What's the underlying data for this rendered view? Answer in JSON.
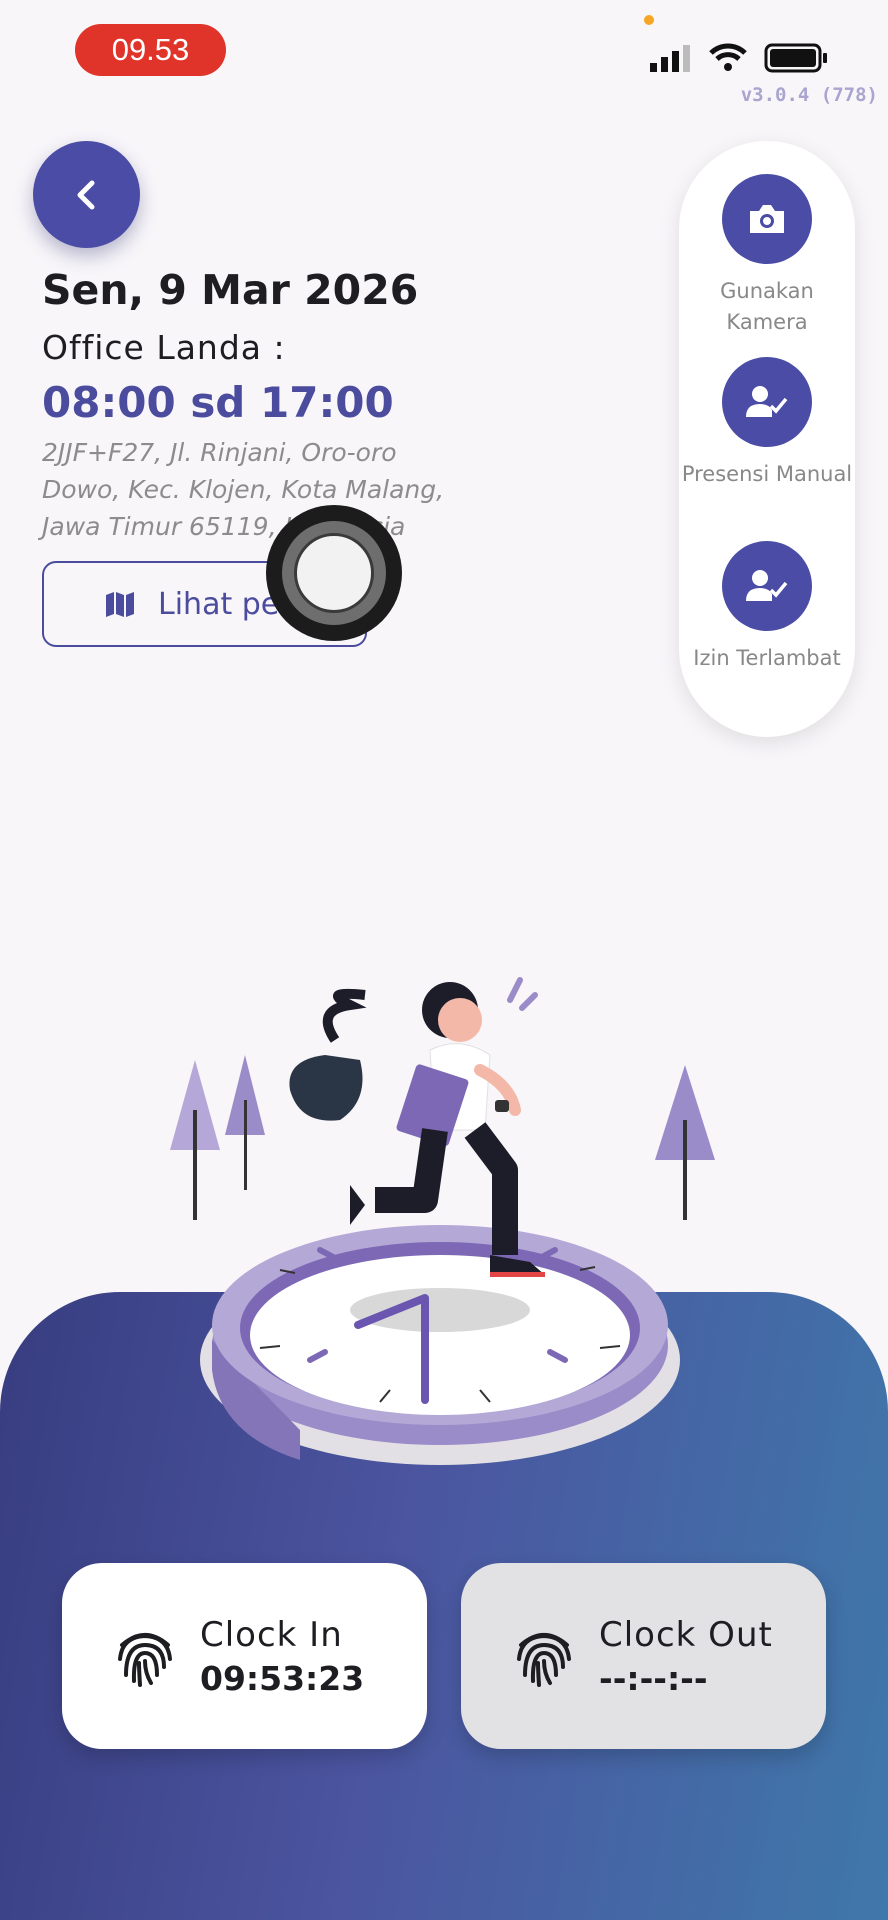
{
  "status_bar": {
    "time": "09.53",
    "version": "v3.0.4 (778)"
  },
  "header": {
    "date": "Sen, 9 Mar 2026",
    "office": "Office Landa :",
    "hours": "08:00 sd 17:00",
    "address": "2JJF+F27, Jl. Rinjani, Oro-oro Dowo, Kec. Klojen, Kota Malang, Jawa Timur 65119, Indonesia",
    "map_button": "Lihat peta"
  },
  "side_menu": [
    {
      "icon": "camera-icon",
      "label": "Gunakan Kamera"
    },
    {
      "icon": "user-check-icon",
      "label": "Presensi Manual"
    },
    {
      "icon": "user-check-icon",
      "label": "Izin Terlambat"
    }
  ],
  "clock_in": {
    "label": "Clock In",
    "time": "09:53:23"
  },
  "clock_out": {
    "label": "Clock Out",
    "time": "--:--:--"
  },
  "colors": {
    "primary": "#4a4ca5",
    "time_pill": "#e0342a",
    "gradient_start": "#383d80",
    "gradient_end": "#3f78aa"
  }
}
